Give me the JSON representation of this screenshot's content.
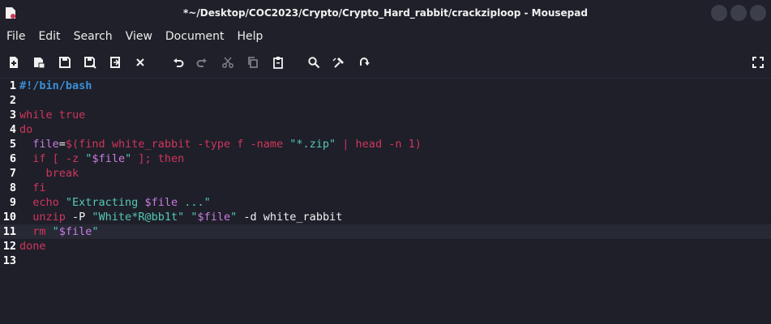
{
  "window": {
    "title": "*~/Desktop/COC2023/Crypto/Crypto_Hard_rabbit/crackziploop - Mousepad"
  },
  "menu": [
    "File",
    "Edit",
    "Search",
    "View",
    "Document",
    "Help"
  ],
  "toolbar": {
    "icons": [
      "new-document-icon",
      "new-window-icon",
      "save-icon",
      "save-as-icon",
      "revert-icon",
      "close-icon",
      "undo-icon",
      "redo-icon",
      "cut-icon",
      "copy-icon",
      "paste-icon",
      "find-icon",
      "replace-icon",
      "goto-icon",
      "fullscreen-icon"
    ]
  },
  "editor": {
    "current_line": 11,
    "lines": [
      {
        "n": "1",
        "parts": [
          {
            "t": "#!/bin/bash",
            "c": "cm"
          }
        ]
      },
      {
        "n": "2",
        "parts": []
      },
      {
        "n": "3",
        "parts": [
          {
            "t": "while",
            "c": "kw"
          },
          {
            "t": " ",
            "c": "pl"
          },
          {
            "t": "true",
            "c": "kw"
          }
        ]
      },
      {
        "n": "4",
        "parts": [
          {
            "t": "do",
            "c": "kw"
          }
        ]
      },
      {
        "n": "5",
        "parts": [
          {
            "t": "  file",
            "c": "var"
          },
          {
            "t": "=",
            "c": "pl"
          },
          {
            "t": "$(find white_rabbit -type f -name ",
            "c": "cmd"
          },
          {
            "t": "\"*.zip\"",
            "c": "str"
          },
          {
            "t": " | head -n 1)",
            "c": "cmd"
          }
        ]
      },
      {
        "n": "6",
        "parts": [
          {
            "t": "  if",
            "c": "kw"
          },
          {
            "t": " [ ",
            "c": "kw"
          },
          {
            "t": "-z ",
            "c": "cmd"
          },
          {
            "t": "\"",
            "c": "str"
          },
          {
            "t": "$file",
            "c": "var"
          },
          {
            "t": "\"",
            "c": "str"
          },
          {
            "t": " ]; then",
            "c": "kw"
          }
        ]
      },
      {
        "n": "7",
        "parts": [
          {
            "t": "    break",
            "c": "kw"
          }
        ]
      },
      {
        "n": "8",
        "parts": [
          {
            "t": "  fi",
            "c": "kw"
          }
        ]
      },
      {
        "n": "9",
        "parts": [
          {
            "t": "  echo ",
            "c": "kw"
          },
          {
            "t": "\"Extracting ",
            "c": "str"
          },
          {
            "t": "$file",
            "c": "var"
          },
          {
            "t": " ...\"",
            "c": "str"
          }
        ]
      },
      {
        "n": "10",
        "parts": [
          {
            "t": "  unzip ",
            "c": "kw"
          },
          {
            "t": "-P ",
            "c": "pl"
          },
          {
            "t": "\"White*R@bb1t\"",
            "c": "str"
          },
          {
            "t": " ",
            "c": "pl"
          },
          {
            "t": "\"",
            "c": "str"
          },
          {
            "t": "$file",
            "c": "var"
          },
          {
            "t": "\"",
            "c": "str"
          },
          {
            "t": " -d white_rabbit",
            "c": "pl"
          }
        ]
      },
      {
        "n": "11",
        "parts": [
          {
            "t": "  rm ",
            "c": "kw"
          },
          {
            "t": "\"",
            "c": "str"
          },
          {
            "t": "$file",
            "c": "var"
          },
          {
            "t": "\"",
            "c": "str"
          }
        ]
      },
      {
        "n": "12",
        "parts": [
          {
            "t": "done",
            "c": "kw"
          }
        ]
      },
      {
        "n": "13",
        "parts": []
      }
    ]
  }
}
